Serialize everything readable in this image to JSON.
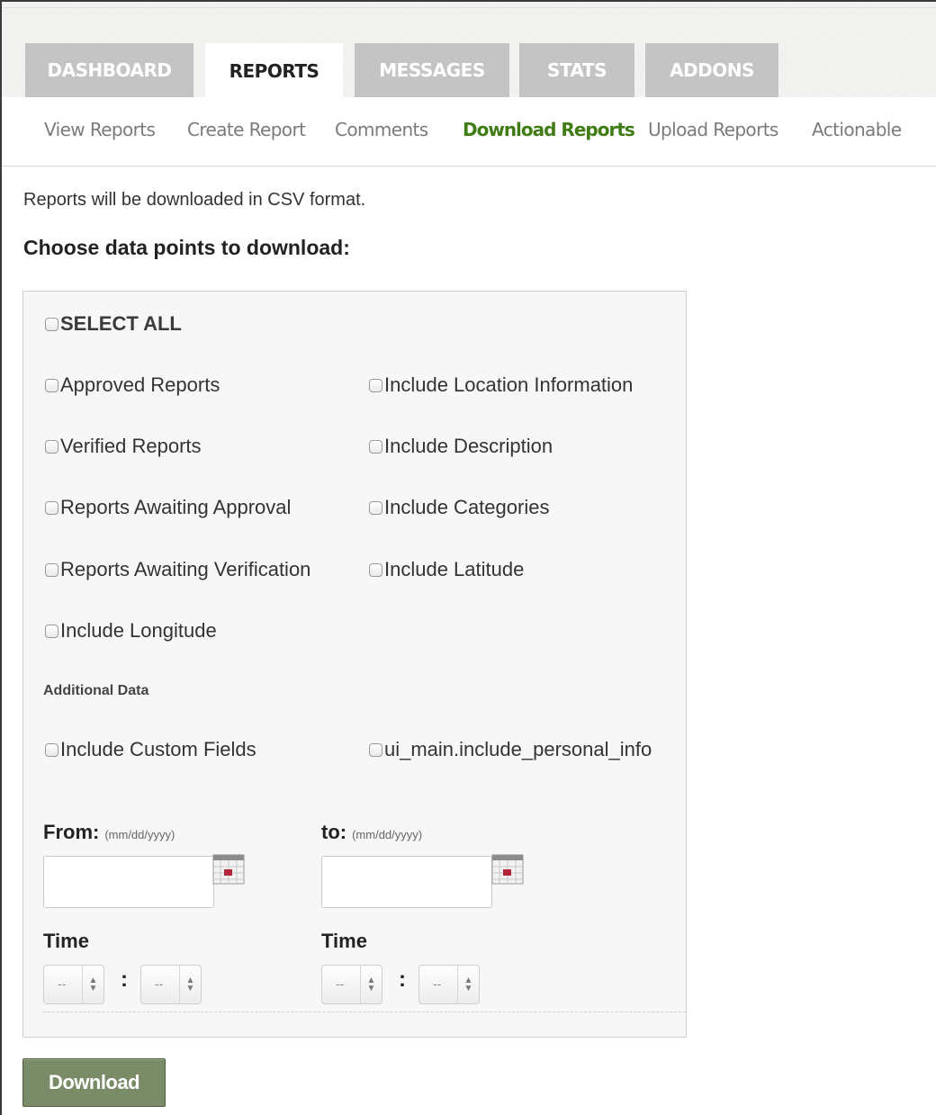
{
  "tabs": [
    {
      "label": "DASHBOARD",
      "active": false
    },
    {
      "label": "REPORTS",
      "active": true
    },
    {
      "label": "MESSAGES",
      "active": false
    },
    {
      "label": "STATS",
      "active": false
    },
    {
      "label": "ADDONS",
      "active": false
    }
  ],
  "subnav": [
    {
      "label": "View Reports",
      "active": false
    },
    {
      "label": "Create Report",
      "active": false
    },
    {
      "label": "Comments",
      "active": false
    },
    {
      "label": "Download Reports",
      "active": true
    },
    {
      "label": "Upload Reports",
      "active": false
    },
    {
      "label": "Actionable",
      "active": false
    }
  ],
  "intro": "Reports will be downloaded in CSV format.",
  "choose_heading": "Choose data points to download:",
  "select_all": "SELECT ALL",
  "options": {
    "approved": "Approved Reports",
    "verified": "Verified Reports",
    "awaiting_approval": "Reports Awaiting Approval",
    "awaiting_verification": "Reports Awaiting Verification",
    "longitude": "Include Longitude",
    "location": "Include Location Information",
    "description": "Include Description",
    "categories": "Include Categories",
    "latitude": "Include Latitude"
  },
  "additional_heading": "Additional Data",
  "additional": {
    "custom_fields": "Include Custom Fields",
    "personal_info": "ui_main.include_personal_info"
  },
  "from": {
    "label": "From:",
    "hint": "(mm/dd/yyyy)",
    "value": ""
  },
  "to": {
    "label": "to:",
    "hint": "(mm/dd/yyyy)",
    "value": ""
  },
  "time_label": "Time",
  "time_placeholder": "--",
  "colon": ":",
  "download_label": "Download",
  "colors": {
    "active_subnav": "#3f7d14",
    "download_button": "#7a8c67",
    "tab_inactive": "#c4c4c4"
  }
}
